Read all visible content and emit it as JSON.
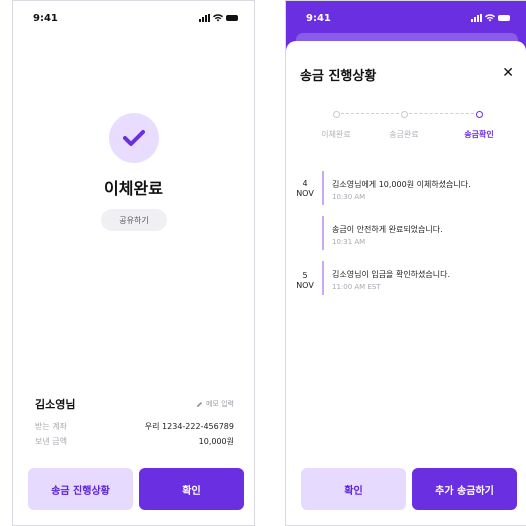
{
  "left": {
    "status_time": "9:41",
    "title": "이체완료",
    "share_label": "공유하기",
    "recipient": "김소영님",
    "memo_label": "메모 입력",
    "rows": [
      {
        "key": "받는 계좌",
        "value": "우리 1234-222-456789"
      },
      {
        "key": "보낸 금액",
        "value": "10,000원"
      }
    ],
    "btn_progress": "송금 진행상황",
    "btn_confirm": "확인"
  },
  "right": {
    "status_time": "9:41",
    "title": "송금 진행상황",
    "steps": [
      "이체완료",
      "송금완료",
      "송금확인"
    ],
    "active_step": 2,
    "events": [
      {
        "day": "4",
        "month": "NOV",
        "text": "김소영님에게 10,000원 이체하셨습니다.",
        "time": "10:30 AM"
      },
      {
        "day": "",
        "month": "",
        "text": "송금이 안전하게 완료되었습니다.",
        "time": "10:31 AM"
      },
      {
        "day": "5",
        "month": "NOV",
        "text": "김소영님이 입금을 확인하셨습니다.",
        "time": "11:00 AM EST"
      }
    ],
    "btn_confirm": "확인",
    "btn_more": "추가 송금하기"
  },
  "colors": {
    "accent": "#6a2fe0",
    "accent_soft": "#e6dbff",
    "timeline": "#c9a9f5"
  },
  "icons": {
    "check": "check-icon",
    "pencil": "pencil-icon",
    "close": "close-icon"
  }
}
